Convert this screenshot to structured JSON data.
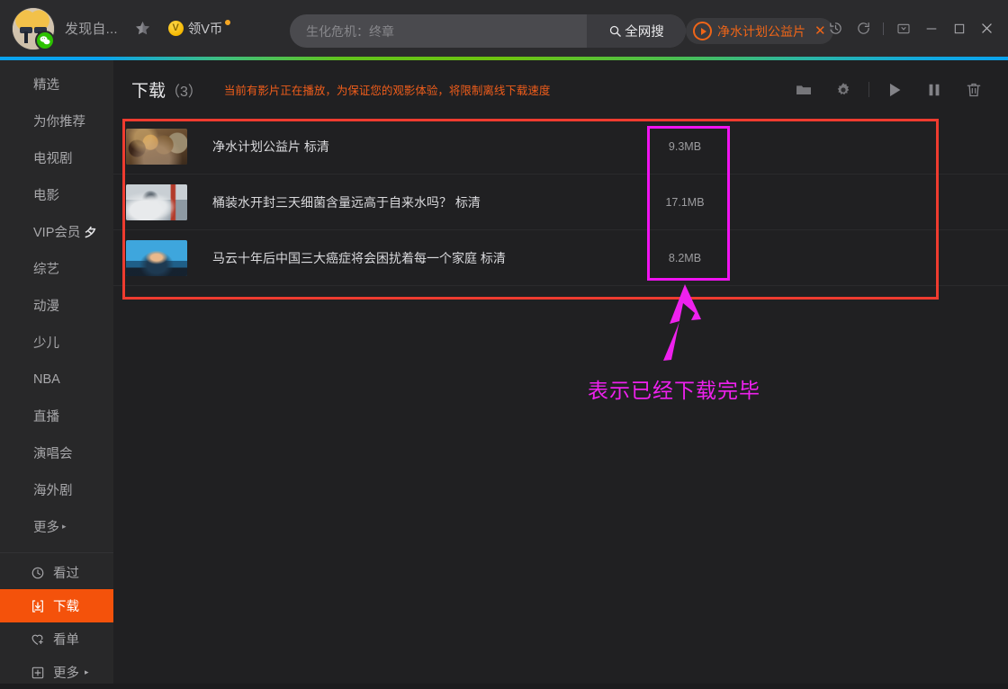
{
  "topbar": {
    "avatar_name": "user-avatar",
    "nickname": "发现自...",
    "star_icon": "star-icon",
    "vcoin": {
      "symbol": "V",
      "label": "领V币"
    },
    "search": {
      "value": "",
      "placeholder": "生化危机：终章",
      "button_label": "全网搜",
      "button_icon": "search-icon"
    },
    "tab": {
      "label": "净水计划公益片",
      "play_icon": "play-circle-icon",
      "close_icon": "close-icon"
    },
    "icons": [
      "history-icon",
      "refresh-icon",
      "window-mode-icon",
      "minimize-icon",
      "maximize-icon",
      "close-icon"
    ]
  },
  "sidebar": {
    "nav": [
      {
        "label": "精选"
      },
      {
        "label": "为你推荐"
      },
      {
        "label": "电视剧"
      },
      {
        "label": "电影"
      },
      {
        "label": "VIP会员",
        "badge": "夕"
      },
      {
        "label": "综艺"
      },
      {
        "label": "动漫"
      },
      {
        "label": "少儿"
      },
      {
        "label": "NBA"
      },
      {
        "label": "直播"
      },
      {
        "label": "演唱会"
      },
      {
        "label": "海外剧"
      },
      {
        "label": "更多",
        "caret": "▸"
      }
    ],
    "bottom": [
      {
        "label": "看过",
        "icon": "history-clock-icon",
        "active": false
      },
      {
        "label": "下载",
        "icon": "download-icon",
        "active": true
      },
      {
        "label": "看单",
        "icon": "heart-plus-icon",
        "active": false
      },
      {
        "label": "更多",
        "icon": "plus-box-icon",
        "active": false,
        "caret": "▸"
      }
    ]
  },
  "main": {
    "header": {
      "title": "下载",
      "count": "（3）",
      "warning": "当前有影片正在播放，为保证您的观影体验，将限制离线下载速度",
      "tools": [
        "folder-icon",
        "gear-icon",
        "play-icon",
        "pause-icon",
        "trash-icon"
      ]
    },
    "rows": [
      {
        "name": "净水计划公益片 标清",
        "size": "9.3MB",
        "thumb": "th1"
      },
      {
        "name": "桶装水开封三天细菌含量远高于自来水吗？ 标清",
        "size": "17.1MB",
        "thumb": "th2"
      },
      {
        "name": "马云十年后中国三大癌症将会困扰着每一个家庭 标清",
        "size": "8.2MB",
        "thumb": "th3"
      }
    ]
  },
  "annotations": {
    "red_box_color": "#ef3b2f",
    "magenta_box_color": "#f013f0",
    "arrow_color": "#ee21ee",
    "caption": "表示已经下载完毕"
  }
}
